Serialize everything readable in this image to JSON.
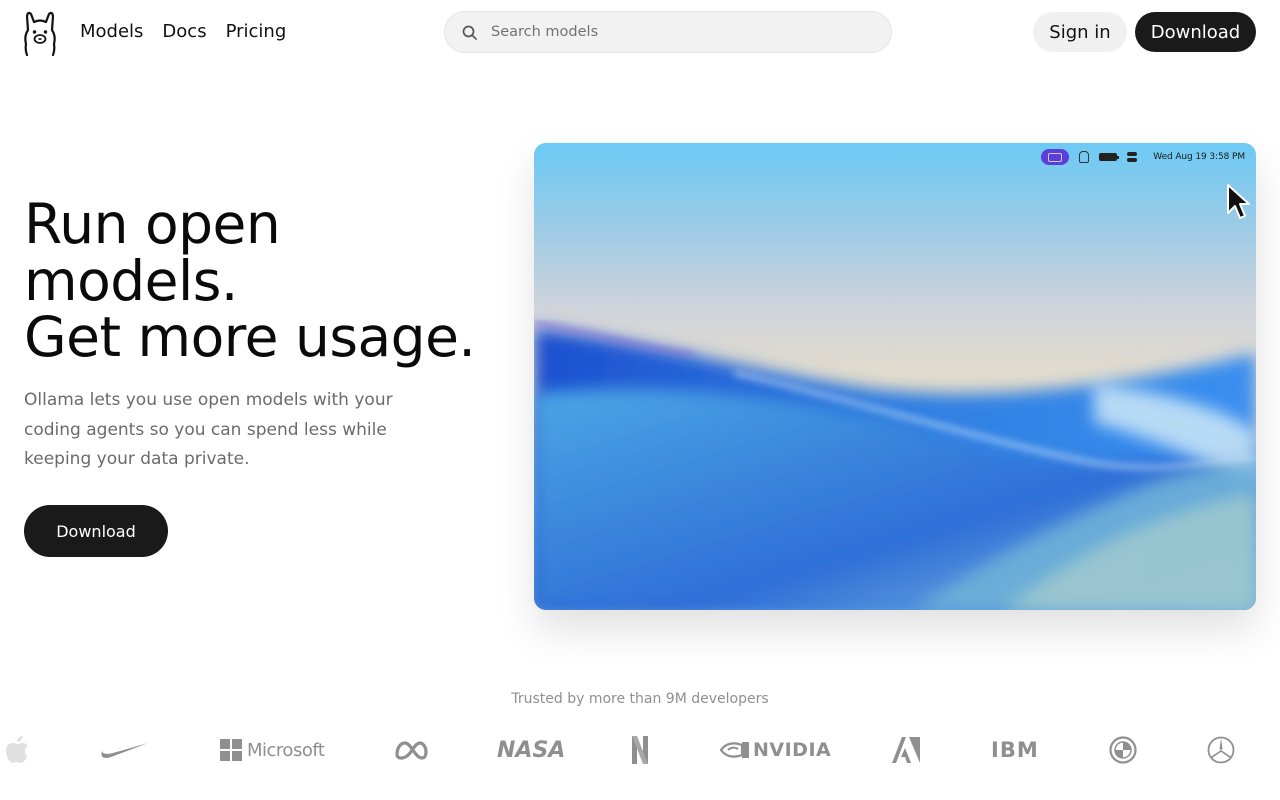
{
  "header": {
    "nav": [
      {
        "label": "Models"
      },
      {
        "label": "Docs"
      },
      {
        "label": "Pricing"
      }
    ],
    "search": {
      "placeholder": "Search models",
      "icon": "search-icon"
    },
    "signin_label": "Sign in",
    "download_label": "Download"
  },
  "hero": {
    "title_lines": [
      "Run open",
      "models.",
      "Get more usage."
    ],
    "subtitle": "Ollama lets you use open models with your coding agents so you can spend less while keeping your data private.",
    "download_label": "Download"
  },
  "screen": {
    "menubar_datetime": "Wed Aug 19  3:58 PM",
    "accent_purple": "#5b3fd6"
  },
  "trusted": {
    "text": "Trusted by more than 9M developers",
    "logos": [
      {
        "name": "apple",
        "label": ""
      },
      {
        "name": "nike",
        "label": ""
      },
      {
        "name": "microsoft",
        "label": "Microsoft"
      },
      {
        "name": "meta",
        "label": ""
      },
      {
        "name": "nasa",
        "label": "NASA"
      },
      {
        "name": "netflix",
        "label": ""
      },
      {
        "name": "nvidia",
        "label": "NVIDIA"
      },
      {
        "name": "adobe",
        "label": ""
      },
      {
        "name": "ibm",
        "label": "IBM"
      },
      {
        "name": "bmw",
        "label": ""
      },
      {
        "name": "mercedes",
        "label": ""
      }
    ]
  },
  "colors": {
    "primary_button": "#1a1a1a",
    "muted_text": "#6b6b6b",
    "logo_gray": "#8f8f8f"
  }
}
